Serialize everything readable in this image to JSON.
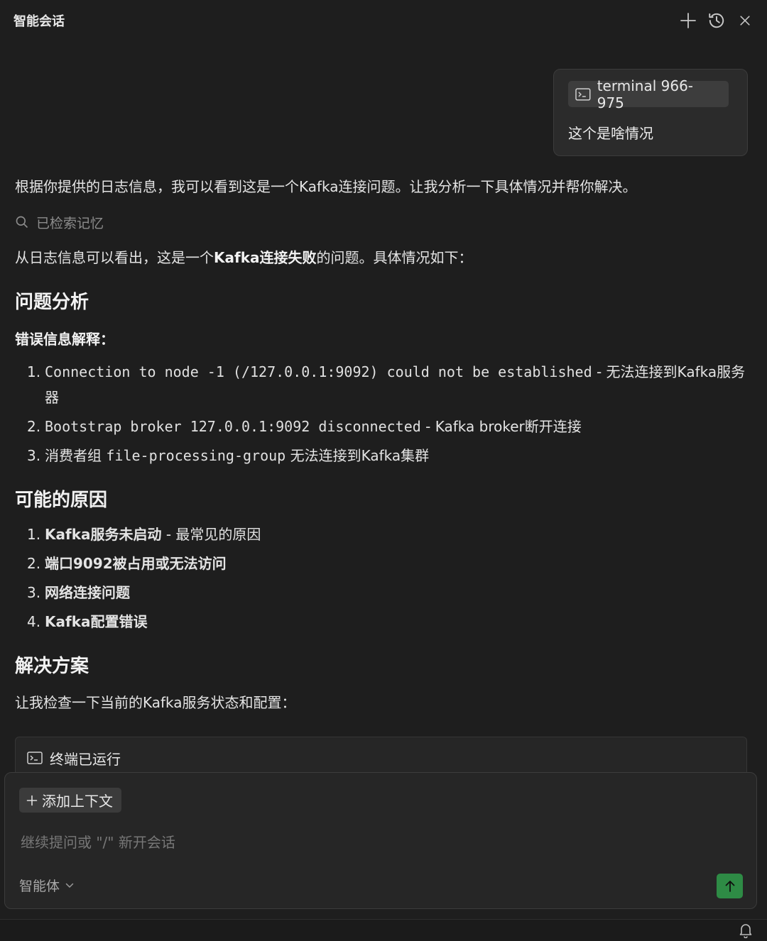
{
  "header": {
    "title": "智能会话",
    "icons": [
      "plus-icon",
      "history-icon",
      "close-icon"
    ]
  },
  "user_message": {
    "context_chip": "terminal 966-975",
    "text": "这个是啥情况"
  },
  "assistant": {
    "intro": "根据你提供的日志信息，我可以看到这是一个Kafka连接问题。让我分析一下具体情况并帮你解决。",
    "memory_status": "已检索记忆",
    "summary": {
      "prefix": "从日志信息可以看出，这是一个",
      "bold": "Kafka连接失败",
      "suffix": "的问题。具体情况如下："
    },
    "section1": {
      "title": "问题分析",
      "subtitle": "错误信息解释：",
      "items": [
        {
          "num": "1.",
          "code": "Connection to node -1 (/127.0.0.1:9092) could not be established",
          "text": " - 无法连接到Kafka服务器"
        },
        {
          "num": "2.",
          "code": "Bootstrap broker 127.0.0.1:9092 disconnected",
          "text": " - Kafka broker断开连接"
        },
        {
          "num": "3.",
          "pre": "消费者组 ",
          "code": "file-processing-group",
          "text": " 无法连接到Kafka集群"
        }
      ]
    },
    "section2": {
      "title": "可能的原因",
      "items": [
        {
          "num": "1.",
          "bold": "Kafka服务未启动",
          "text": " - 最常见的原因"
        },
        {
          "num": "2.",
          "bold": "端口9092被占用或无法访问",
          "text": ""
        },
        {
          "num": "3.",
          "bold": "网络连接问题",
          "text": ""
        },
        {
          "num": "4.",
          "bold": "Kafka配置错误",
          "text": ""
        }
      ]
    },
    "section3": {
      "title": "解决方案",
      "text": "让我检查一下当前的Kafka服务状态和配置："
    },
    "terminal_status": "终端已运行"
  },
  "input": {
    "add_context_label": "添加上下文",
    "placeholder": "继续提问或 \"/\" 新开会话",
    "value": "",
    "agent_mode": "智能体"
  },
  "colors": {
    "background": "#1e1e1e",
    "panel": "#262626",
    "send_button": "#2e8b45"
  }
}
